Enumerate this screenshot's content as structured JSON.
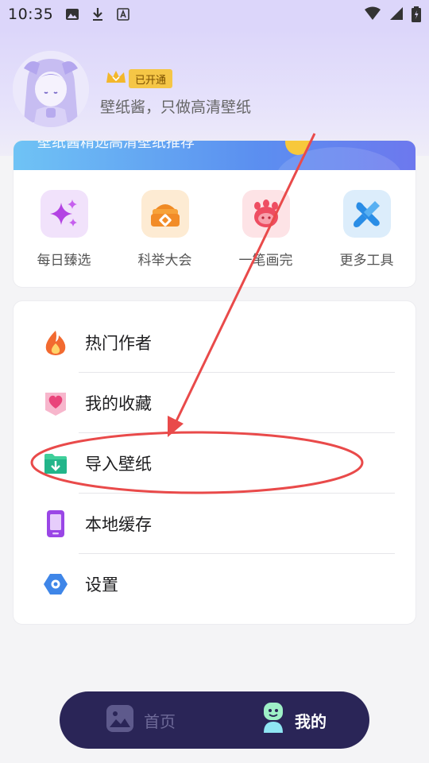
{
  "status_bar": {
    "time": "10:35"
  },
  "profile": {
    "vip_badge": "已开通",
    "tagline": "壁纸酱，只做高清壁纸"
  },
  "banner": {
    "partial_text": "壁纸酱精选高清壁纸推荐"
  },
  "tools": [
    {
      "label": "每日臻选",
      "icon": "sparkle-icon"
    },
    {
      "label": "科举大会",
      "icon": "treasure-icon"
    },
    {
      "label": "一笔画完",
      "icon": "paw-icon"
    },
    {
      "label": "更多工具",
      "icon": "tools-icon"
    }
  ],
  "menu": [
    {
      "label": "热门作者",
      "icon": "flame-icon"
    },
    {
      "label": "我的收藏",
      "icon": "heart-icon"
    },
    {
      "label": "导入壁纸",
      "icon": "folder-download-icon"
    },
    {
      "label": "本地缓存",
      "icon": "phone-icon"
    },
    {
      "label": "设置",
      "icon": "settings-hexagon-icon"
    }
  ],
  "bottom_nav": {
    "home_label": "首页",
    "mine_label": "我的"
  },
  "colors": {
    "header_bg": "#dcd6fa",
    "nav_bg": "#2a2557",
    "annotation_red": "#e94a4a",
    "vip_gold": "#f5c646"
  }
}
